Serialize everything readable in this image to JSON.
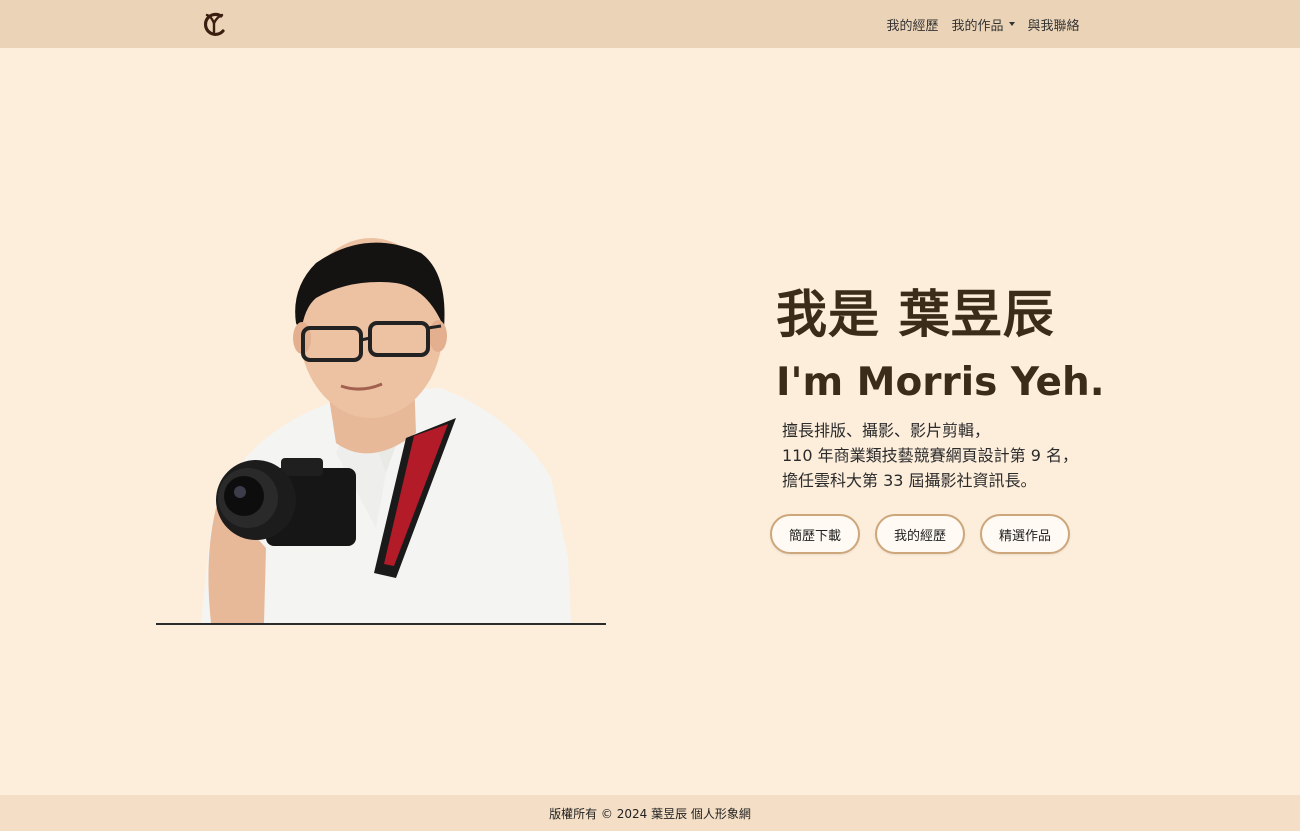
{
  "nav": {
    "logo_icon": "yc-monogram-logo",
    "links": [
      {
        "label": "我的經歷"
      },
      {
        "label": "我的作品",
        "has_dropdown": true
      },
      {
        "label": "與我聯絡"
      }
    ]
  },
  "hero": {
    "title_cn": "我是 葉昱辰",
    "title_en": "I'm Morris Yeh.",
    "intro_lines": [
      "擅長排版、攝影、影片剪輯，",
      "110 年商業類技藝競賽網頁設計第 9 名，",
      "擔任雲科大第 33 屆攝影社資訊長。"
    ],
    "buttons": [
      {
        "label": "簡歷下載"
      },
      {
        "label": "我的經歷"
      },
      {
        "label": "精選作品"
      }
    ]
  },
  "footer": {
    "text": "版權所有 © 2024 葉昱辰 個人形象網"
  },
  "colors": {
    "background": "#fdeedc",
    "navbar": "#ead3b6",
    "footer": "#f4dfc6",
    "title": "#3b2c1a",
    "button_border": "#cda77b"
  }
}
